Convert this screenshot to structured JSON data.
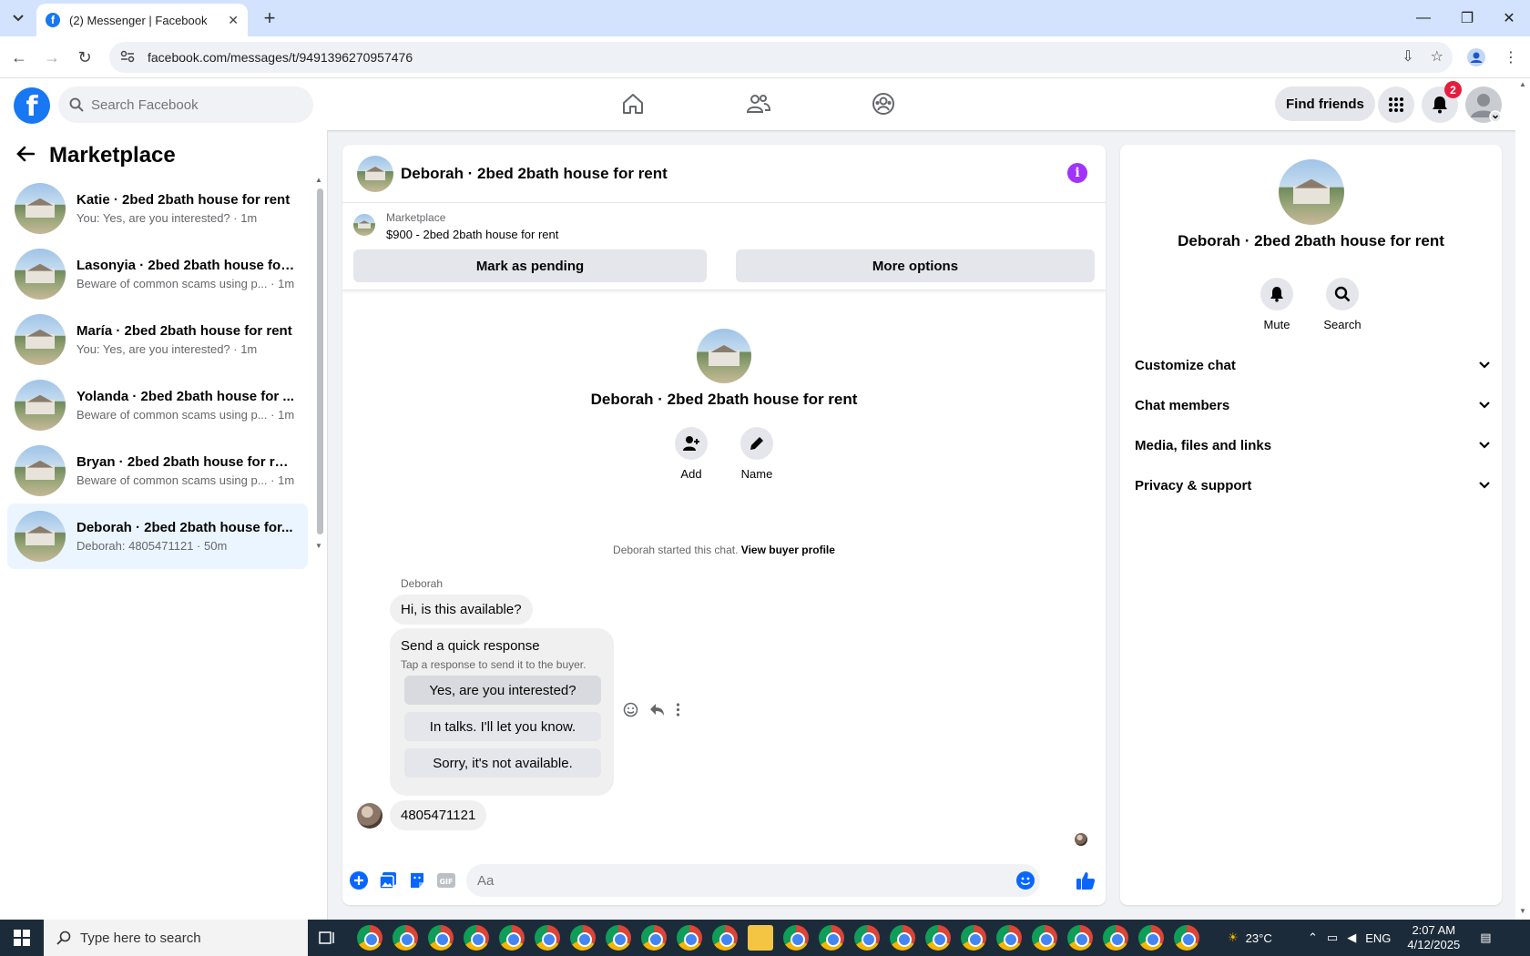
{
  "browser": {
    "tab_title": "(2) Messenger | Facebook",
    "url": "facebook.com/messages/t/9491396270957476"
  },
  "fb": {
    "search_placeholder": "Search Facebook",
    "find_friends": "Find friends",
    "notification_count": "2"
  },
  "sidebar": {
    "title": "Marketplace",
    "conversations": [
      {
        "name": "Katie · 2bed 2bath house for rent",
        "snippet": "You: Yes, are you interested? · 1m"
      },
      {
        "name": "Lasonyia · 2bed 2bath house for...",
        "snippet": "Beware of common scams using p... · 1m"
      },
      {
        "name": "María · 2bed 2bath house for rent",
        "snippet": "You: Yes, are you interested? · 1m"
      },
      {
        "name": "Yolanda · 2bed 2bath house for ...",
        "snippet": "Beware of common scams using p... · 1m"
      },
      {
        "name": "Bryan · 2bed 2bath house for rent",
        "snippet": "Beware of common scams using p... · 1m"
      },
      {
        "name": "Deborah · 2bed 2bath house for...",
        "snippet": "Deborah: 4805471121 · 50m"
      }
    ]
  },
  "chat": {
    "title": "Deborah · 2bed 2bath house for rent",
    "listing_source": "Marketplace",
    "listing_price": "$900 - 2bed 2bath house for rent",
    "mark_pending": "Mark as pending",
    "more_options": "More options",
    "intro_name": "Deborah · 2bed 2bath house for rent",
    "add_label": "Add",
    "name_label": "Name",
    "started_text": "Deborah started this chat.",
    "view_buyer_profile": "View buyer profile",
    "sender": "Deborah",
    "message1": "Hi, is this available?",
    "quick_title": "Send a quick response",
    "quick_sub": "Tap a response to send it to the buyer.",
    "quick_responses": [
      "Yes, are you interested?",
      "In talks. I'll let you know.",
      "Sorry, it's not available."
    ],
    "message2": "4805471121",
    "composer_placeholder": "Aa"
  },
  "details": {
    "name": "Deborah · 2bed 2bath house for rent",
    "mute": "Mute",
    "search": "Search",
    "sections": [
      "Customize chat",
      "Chat members",
      "Media, files and links",
      "Privacy & support"
    ]
  },
  "taskbar": {
    "search_placeholder": "Type here to search",
    "weather": "23°C",
    "lang": "ENG",
    "time": "2:07 AM",
    "date": "4/12/2025"
  },
  "colors": {
    "fb_blue": "#1877f2",
    "active_conv_bg": "#ebf5ff",
    "info_purple": "#a033ff",
    "badge_red": "#e41e3f"
  }
}
